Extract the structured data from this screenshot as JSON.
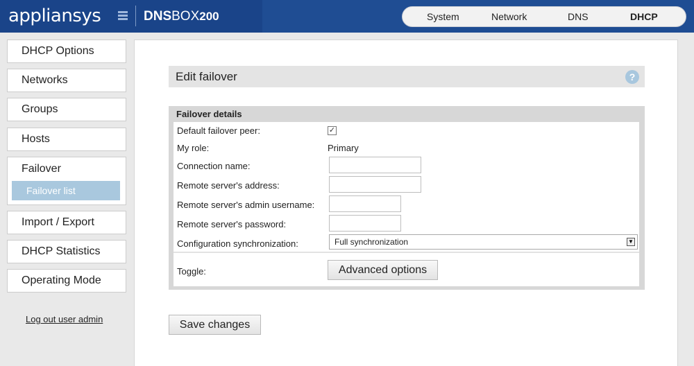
{
  "header": {
    "logo_text": "appliansys",
    "product_strong": "DNS",
    "product_light": "BOX",
    "product_num": "200",
    "nav": [
      {
        "label": "System"
      },
      {
        "label": "Network"
      },
      {
        "label": "DNS"
      },
      {
        "label": "DHCP",
        "active": true
      }
    ]
  },
  "sidebar": {
    "items": [
      {
        "label": "DHCP Options"
      },
      {
        "label": "Networks"
      },
      {
        "label": "Groups"
      },
      {
        "label": "Hosts"
      },
      {
        "label": "Failover"
      },
      {
        "label": "Import / Export"
      },
      {
        "label": "DHCP Statistics"
      },
      {
        "label": "Operating Mode"
      }
    ],
    "failover_sub": "Failover list",
    "logout": "Log out user admin"
  },
  "main": {
    "title": "Edit failover",
    "help_symbol": "?",
    "fieldset_title": "Failover details",
    "rows": {
      "default_peer_label": "Default failover peer:",
      "default_peer_checked": true,
      "my_role_label": "My role:",
      "my_role_value": "Primary",
      "connection_name_label": "Connection name:",
      "connection_name_value": "",
      "remote_address_label": "Remote server's address:",
      "remote_address_value": "",
      "remote_username_label": "Remote server's admin username:",
      "remote_username_value": "",
      "remote_password_label": "Remote server's password:",
      "remote_password_value": "",
      "config_sync_label": "Configuration synchronization:",
      "config_sync_value": "Full synchronization",
      "toggle_label": "Toggle:"
    },
    "advanced_button": "Advanced options",
    "save_button": "Save changes"
  },
  "colors": {
    "header_bg": "#1f4d93",
    "active_sub": "#a9c8de",
    "panel_title_bg": "#e4e4e4"
  }
}
